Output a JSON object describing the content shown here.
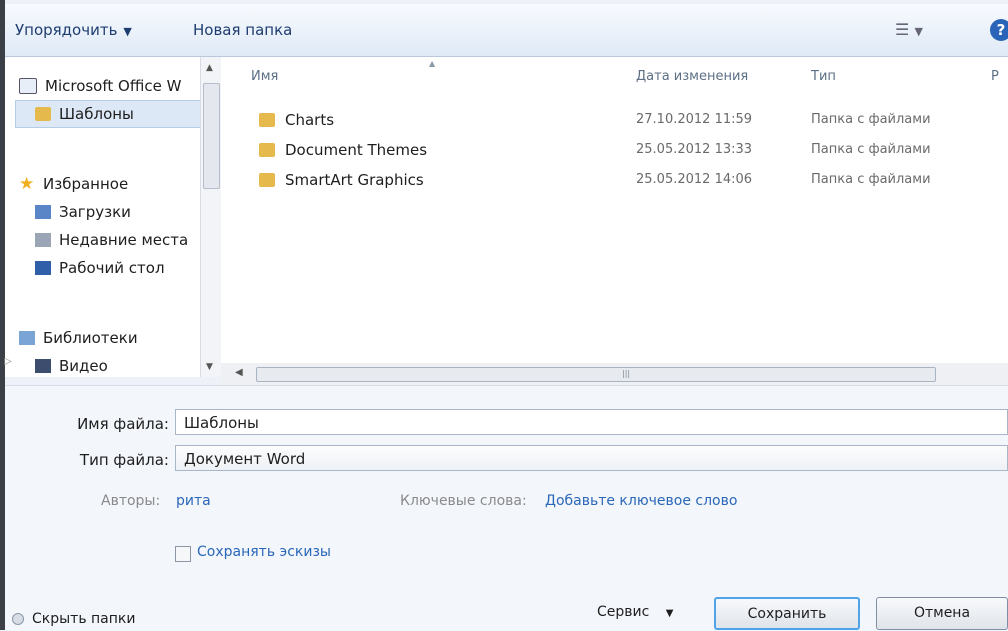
{
  "toolbar": {
    "organize": "Упорядочить",
    "new_folder": "Новая папка",
    "help": "?"
  },
  "nav": {
    "office": "Microsoft Office W",
    "templates": "Шаблоны",
    "favorites": "Избранное",
    "downloads": "Загрузки",
    "recent": "Недавние места",
    "desktop": "Рабочий стол",
    "libraries": "Библиотеки",
    "video": "Видео"
  },
  "list": {
    "columns": {
      "name": "Имя",
      "date": "Дата изменения",
      "type": "Тип",
      "size": "Р"
    },
    "rows": [
      {
        "name": "Charts",
        "date": "27.10.2012 11:59",
        "type": "Папка с файлами"
      },
      {
        "name": "Document Themes",
        "date": "25.05.2012 13:33",
        "type": "Папка с файлами"
      },
      {
        "name": "SmartArt Graphics",
        "date": "25.05.2012 14:06",
        "type": "Папка с файлами"
      }
    ]
  },
  "form": {
    "filename_label": "Имя файла:",
    "filename_value": "Шаблоны",
    "filetype_label": "Тип файла:",
    "filetype_value": "Документ Word",
    "authors_label": "Авторы:",
    "authors_value": "рита",
    "keywords_label": "Ключевые слова:",
    "keywords_value": "Добавьте ключевое слово",
    "thumbs_label": "Сохранять эскизы"
  },
  "footer": {
    "hide_folders": "Скрыть папки",
    "service": "Сервис",
    "save": "Сохранить",
    "cancel": "Отмена"
  }
}
